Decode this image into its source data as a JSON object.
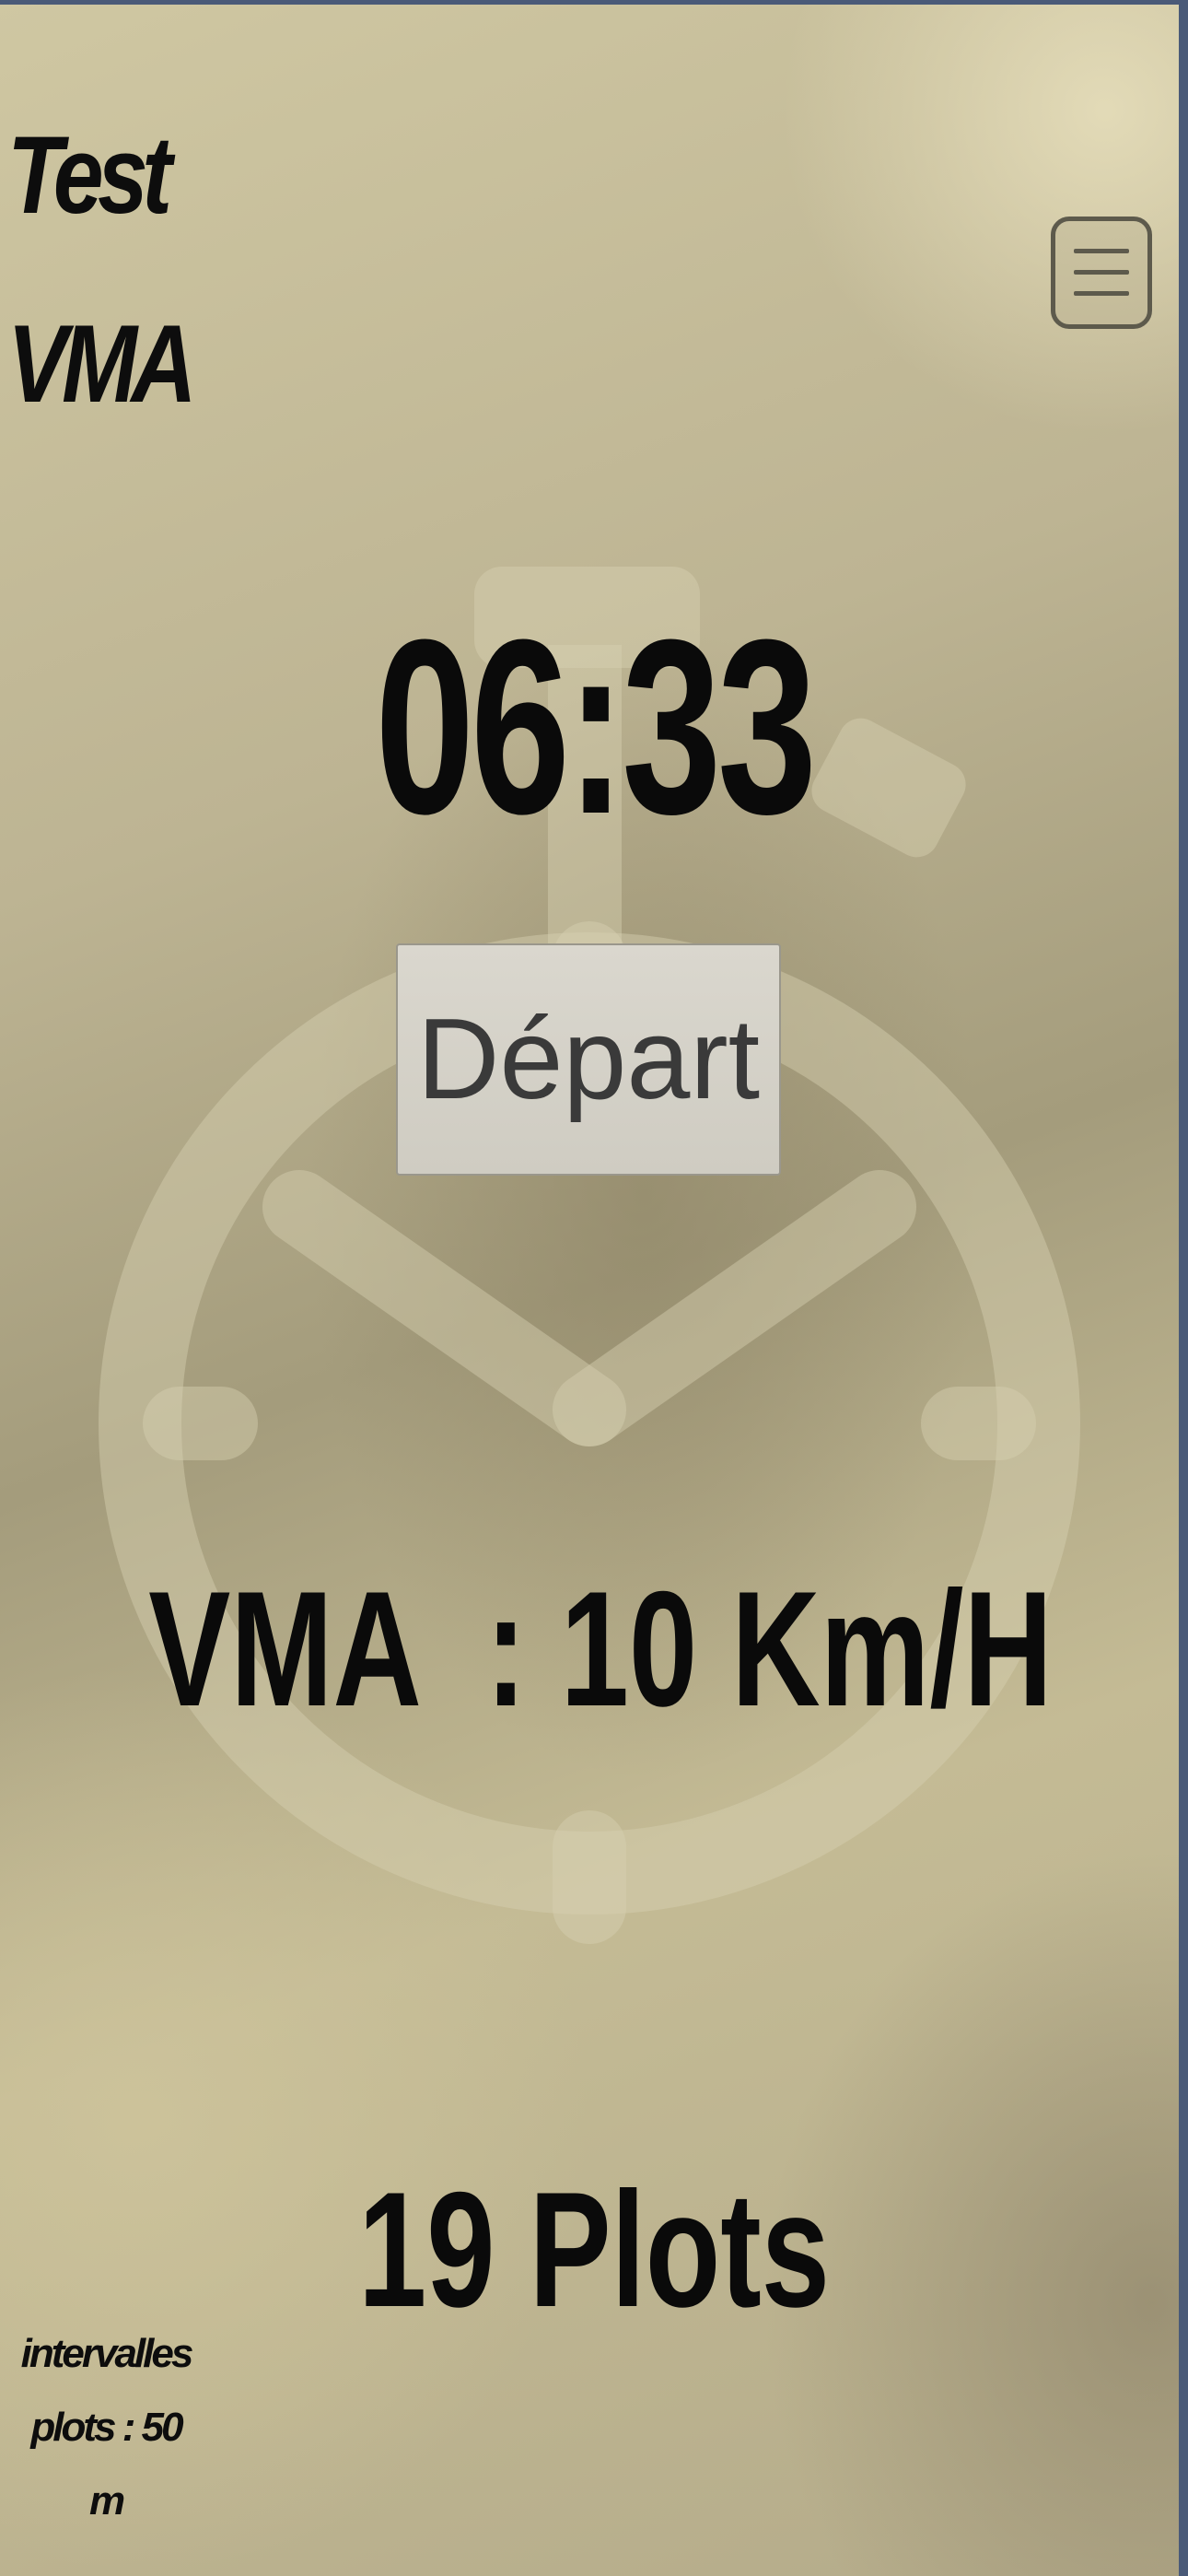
{
  "app": {
    "title_line1": "Test",
    "title_line2": "VMA"
  },
  "header": {
    "menu_icon": "hamburger-menu-icon"
  },
  "background": {
    "icon": "stopwatch-icon"
  },
  "timer": {
    "value": "06:33"
  },
  "controls": {
    "start_label": "Départ"
  },
  "result": {
    "vma_text": "VMA  : 10 Km/H",
    "plots_text": "19 Plots"
  },
  "footer": {
    "interval_line1": "intervalles",
    "interval_line2": "plots : 50",
    "interval_line3": "m"
  },
  "colors": {
    "text": "#0a0a0a",
    "button_bg": "#d6d3c9",
    "button_text": "#3a3a3a",
    "watermark": "#d8d1b2"
  }
}
